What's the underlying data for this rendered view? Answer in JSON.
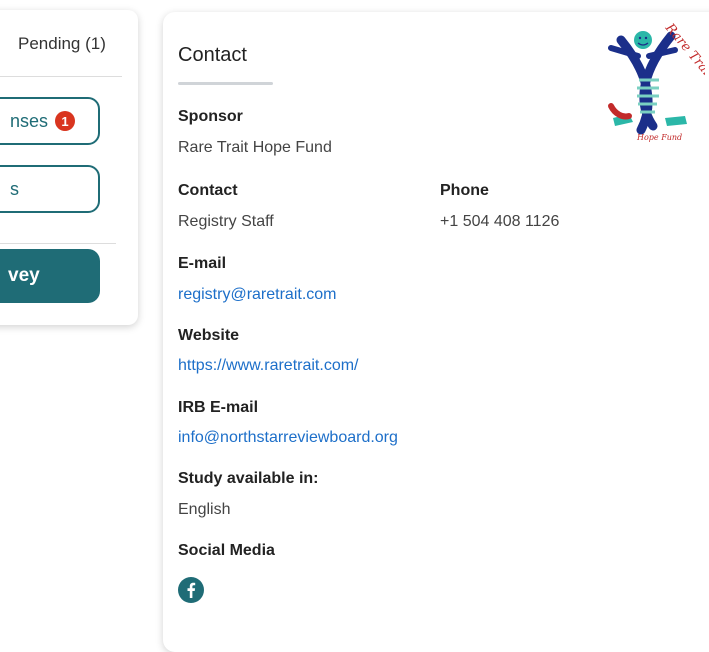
{
  "left_panel": {
    "pending_tab": "Pending (1)",
    "responses_button": "nses",
    "responses_badge": "1",
    "results_button": "s",
    "survey_button": "vey"
  },
  "contact": {
    "title": "Contact",
    "sponsor_label": "Sponsor",
    "sponsor_value": "Rare Trait Hope Fund",
    "contact_label": "Contact",
    "contact_value": "Registry Staff",
    "phone_label": "Phone",
    "phone_value": "+1 504 408 1126",
    "email_label": "E-mail",
    "email_value": "registry@raretrait.com",
    "website_label": "Website",
    "website_value": "https://www.raretrait.com/",
    "irb_email_label": "IRB E-mail",
    "irb_email_value": "info@northstarreviewboard.org",
    "language_label": "Study available in:",
    "language_value": "English",
    "social_label": "Social Media"
  },
  "logo": {
    "top_text": "Rare Trait",
    "bottom_text": "Hope Fund"
  },
  "colors": {
    "primary_teal": "#1f6c76",
    "link_blue": "#1d6fc9",
    "badge_red": "#d9351f"
  },
  "icons": [
    "facebook-icon"
  ]
}
